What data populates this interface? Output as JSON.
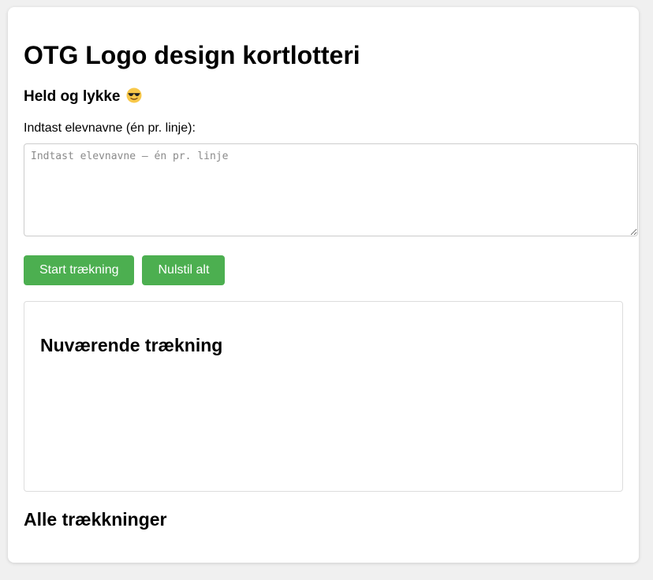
{
  "page": {
    "title": "OTG Logo design kortlotteri",
    "subtitle": "Held og lykke",
    "subtitle_emoji": "smiling-face-with-sunglasses-icon"
  },
  "names_input": {
    "label": "Indtast elevnavne (én pr. linje):",
    "value": "",
    "placeholder": "Indtast elevnavne – én pr. linje"
  },
  "buttons": {
    "start_label": "Start trækning",
    "reset_label": "Nulstil alt"
  },
  "current_draw": {
    "heading": "Nuværende trækning"
  },
  "all_draws": {
    "heading": "Alle trækkninger"
  },
  "colors": {
    "accent": "#4caf50",
    "background": "#f0f0f0",
    "card": "#ffffff"
  }
}
